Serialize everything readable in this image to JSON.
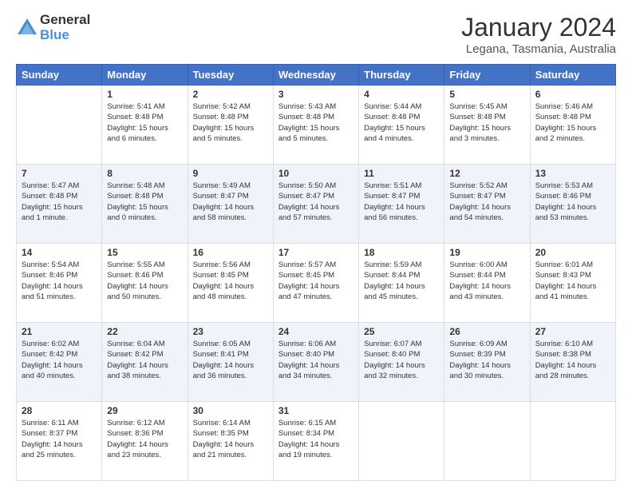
{
  "logo": {
    "general": "General",
    "blue": "Blue"
  },
  "header": {
    "month": "January 2024",
    "location": "Legana, Tasmania, Australia"
  },
  "weekdays": [
    "Sunday",
    "Monday",
    "Tuesday",
    "Wednesday",
    "Thursday",
    "Friday",
    "Saturday"
  ],
  "weeks": [
    [
      {
        "day": "",
        "info": ""
      },
      {
        "day": "1",
        "info": "Sunrise: 5:41 AM\nSunset: 8:48 PM\nDaylight: 15 hours\nand 6 minutes."
      },
      {
        "day": "2",
        "info": "Sunrise: 5:42 AM\nSunset: 8:48 PM\nDaylight: 15 hours\nand 5 minutes."
      },
      {
        "day": "3",
        "info": "Sunrise: 5:43 AM\nSunset: 8:48 PM\nDaylight: 15 hours\nand 5 minutes."
      },
      {
        "day": "4",
        "info": "Sunrise: 5:44 AM\nSunset: 8:48 PM\nDaylight: 15 hours\nand 4 minutes."
      },
      {
        "day": "5",
        "info": "Sunrise: 5:45 AM\nSunset: 8:48 PM\nDaylight: 15 hours\nand 3 minutes."
      },
      {
        "day": "6",
        "info": "Sunrise: 5:46 AM\nSunset: 8:48 PM\nDaylight: 15 hours\nand 2 minutes."
      }
    ],
    [
      {
        "day": "7",
        "info": "Sunrise: 5:47 AM\nSunset: 8:48 PM\nDaylight: 15 hours\nand 1 minute."
      },
      {
        "day": "8",
        "info": "Sunrise: 5:48 AM\nSunset: 8:48 PM\nDaylight: 15 hours\nand 0 minutes."
      },
      {
        "day": "9",
        "info": "Sunrise: 5:49 AM\nSunset: 8:47 PM\nDaylight: 14 hours\nand 58 minutes."
      },
      {
        "day": "10",
        "info": "Sunrise: 5:50 AM\nSunset: 8:47 PM\nDaylight: 14 hours\nand 57 minutes."
      },
      {
        "day": "11",
        "info": "Sunrise: 5:51 AM\nSunset: 8:47 PM\nDaylight: 14 hours\nand 56 minutes."
      },
      {
        "day": "12",
        "info": "Sunrise: 5:52 AM\nSunset: 8:47 PM\nDaylight: 14 hours\nand 54 minutes."
      },
      {
        "day": "13",
        "info": "Sunrise: 5:53 AM\nSunset: 8:46 PM\nDaylight: 14 hours\nand 53 minutes."
      }
    ],
    [
      {
        "day": "14",
        "info": "Sunrise: 5:54 AM\nSunset: 8:46 PM\nDaylight: 14 hours\nand 51 minutes."
      },
      {
        "day": "15",
        "info": "Sunrise: 5:55 AM\nSunset: 8:46 PM\nDaylight: 14 hours\nand 50 minutes."
      },
      {
        "day": "16",
        "info": "Sunrise: 5:56 AM\nSunset: 8:45 PM\nDaylight: 14 hours\nand 48 minutes."
      },
      {
        "day": "17",
        "info": "Sunrise: 5:57 AM\nSunset: 8:45 PM\nDaylight: 14 hours\nand 47 minutes."
      },
      {
        "day": "18",
        "info": "Sunrise: 5:59 AM\nSunset: 8:44 PM\nDaylight: 14 hours\nand 45 minutes."
      },
      {
        "day": "19",
        "info": "Sunrise: 6:00 AM\nSunset: 8:44 PM\nDaylight: 14 hours\nand 43 minutes."
      },
      {
        "day": "20",
        "info": "Sunrise: 6:01 AM\nSunset: 8:43 PM\nDaylight: 14 hours\nand 41 minutes."
      }
    ],
    [
      {
        "day": "21",
        "info": "Sunrise: 6:02 AM\nSunset: 8:42 PM\nDaylight: 14 hours\nand 40 minutes."
      },
      {
        "day": "22",
        "info": "Sunrise: 6:04 AM\nSunset: 8:42 PM\nDaylight: 14 hours\nand 38 minutes."
      },
      {
        "day": "23",
        "info": "Sunrise: 6:05 AM\nSunset: 8:41 PM\nDaylight: 14 hours\nand 36 minutes."
      },
      {
        "day": "24",
        "info": "Sunrise: 6:06 AM\nSunset: 8:40 PM\nDaylight: 14 hours\nand 34 minutes."
      },
      {
        "day": "25",
        "info": "Sunrise: 6:07 AM\nSunset: 8:40 PM\nDaylight: 14 hours\nand 32 minutes."
      },
      {
        "day": "26",
        "info": "Sunrise: 6:09 AM\nSunset: 8:39 PM\nDaylight: 14 hours\nand 30 minutes."
      },
      {
        "day": "27",
        "info": "Sunrise: 6:10 AM\nSunset: 8:38 PM\nDaylight: 14 hours\nand 28 minutes."
      }
    ],
    [
      {
        "day": "28",
        "info": "Sunrise: 6:11 AM\nSunset: 8:37 PM\nDaylight: 14 hours\nand 25 minutes."
      },
      {
        "day": "29",
        "info": "Sunrise: 6:12 AM\nSunset: 8:36 PM\nDaylight: 14 hours\nand 23 minutes."
      },
      {
        "day": "30",
        "info": "Sunrise: 6:14 AM\nSunset: 8:35 PM\nDaylight: 14 hours\nand 21 minutes."
      },
      {
        "day": "31",
        "info": "Sunrise: 6:15 AM\nSunset: 8:34 PM\nDaylight: 14 hours\nand 19 minutes."
      },
      {
        "day": "",
        "info": ""
      },
      {
        "day": "",
        "info": ""
      },
      {
        "day": "",
        "info": ""
      }
    ]
  ]
}
